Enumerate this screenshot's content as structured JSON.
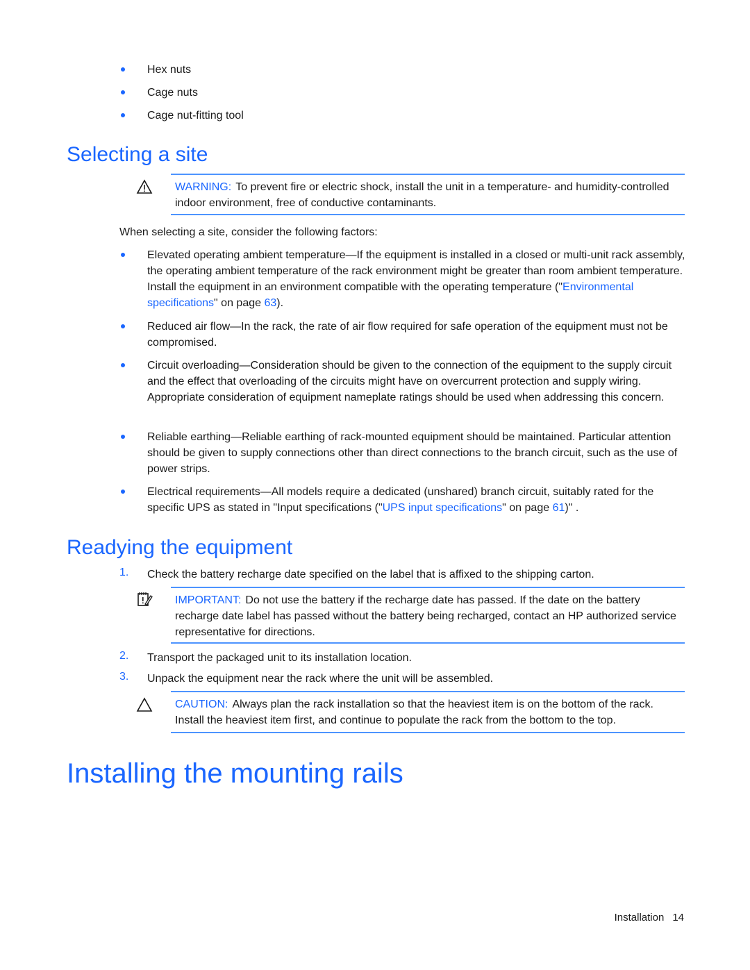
{
  "top_list": [
    "Hex nuts",
    "Cage nuts",
    "Cage nut-fitting tool"
  ],
  "section_site": {
    "heading": "Selecting a site",
    "warning": {
      "icon": "warning-triangle-icon",
      "label": "WARNING:",
      "text": "To prevent fire or electric shock, install the unit in a temperature- and humidity-controlled indoor environment, free of conductive contaminants."
    },
    "intro": "When selecting a site, consider the following factors:",
    "factors": [
      {
        "text": "Elevated operating ambient temperature—If the equipment is installed in a closed or multi-unit rack assembly, the operating ambient temperature of the rack environment might be greater than room ambient temperature. Install the equipment in an environment compatible with the operating temperature (\"",
        "link": "Environmental specifications",
        "mid": "\" on page ",
        "page_link": "63",
        "tail": ")."
      },
      {
        "text": "Reduced air flow—In the rack, the rate of air flow required for safe operation of the equipment must not be compromised."
      },
      {
        "text": "Circuit overloading—Consideration should be given to the connection of the equipment to the supply circuit and the effect that overloading of the circuits might have on overcurrent protection and supply wiring. Appropriate consideration of equipment nameplate ratings should be used when addressing this concern."
      },
      {
        "text": "Reliable earthing—Reliable earthing of rack-mounted equipment should be maintained. Particular attention should be given to supply connections other than direct connections to the branch circuit, such as the use of power strips."
      },
      {
        "text": "Electrical requirements—All models require a dedicated (unshared) branch circuit, suitably rated for the specific UPS as stated in \"Input specifications (\"",
        "link": "UPS input specifications",
        "mid": "\" on page ",
        "page_link": "61",
        "tail": ")\" ."
      }
    ]
  },
  "section_ready": {
    "heading": "Readying the equipment",
    "steps": [
      {
        "num": "1.",
        "text": "Check the battery recharge date specified on the label that is affixed to the shipping carton."
      },
      {
        "num": "2.",
        "text": "Transport the packaged unit to its installation location."
      },
      {
        "num": "3.",
        "text": "Unpack the equipment near the rack where the unit will be assembled."
      }
    ],
    "important": {
      "icon": "important-notepad-icon",
      "label": "IMPORTANT:",
      "text": "Do not use the battery if the recharge date has passed. If the date on the battery recharge date label has passed without the battery being recharged, contact an HP authorized service representative for directions."
    },
    "caution": {
      "icon": "caution-triangle-icon",
      "label": "CAUTION:",
      "text": "Always plan the rack installation so that the heaviest item is on the bottom of the rack. Install the heaviest item first, and continue to populate the rack from the bottom to the top."
    }
  },
  "section_rails": {
    "heading": "Installing the mounting rails"
  },
  "footer": {
    "section": "Installation",
    "page": "14"
  },
  "colors": {
    "accent": "#1a66ff",
    "rule": "#4d94ff",
    "text": "#1a1a1a"
  }
}
